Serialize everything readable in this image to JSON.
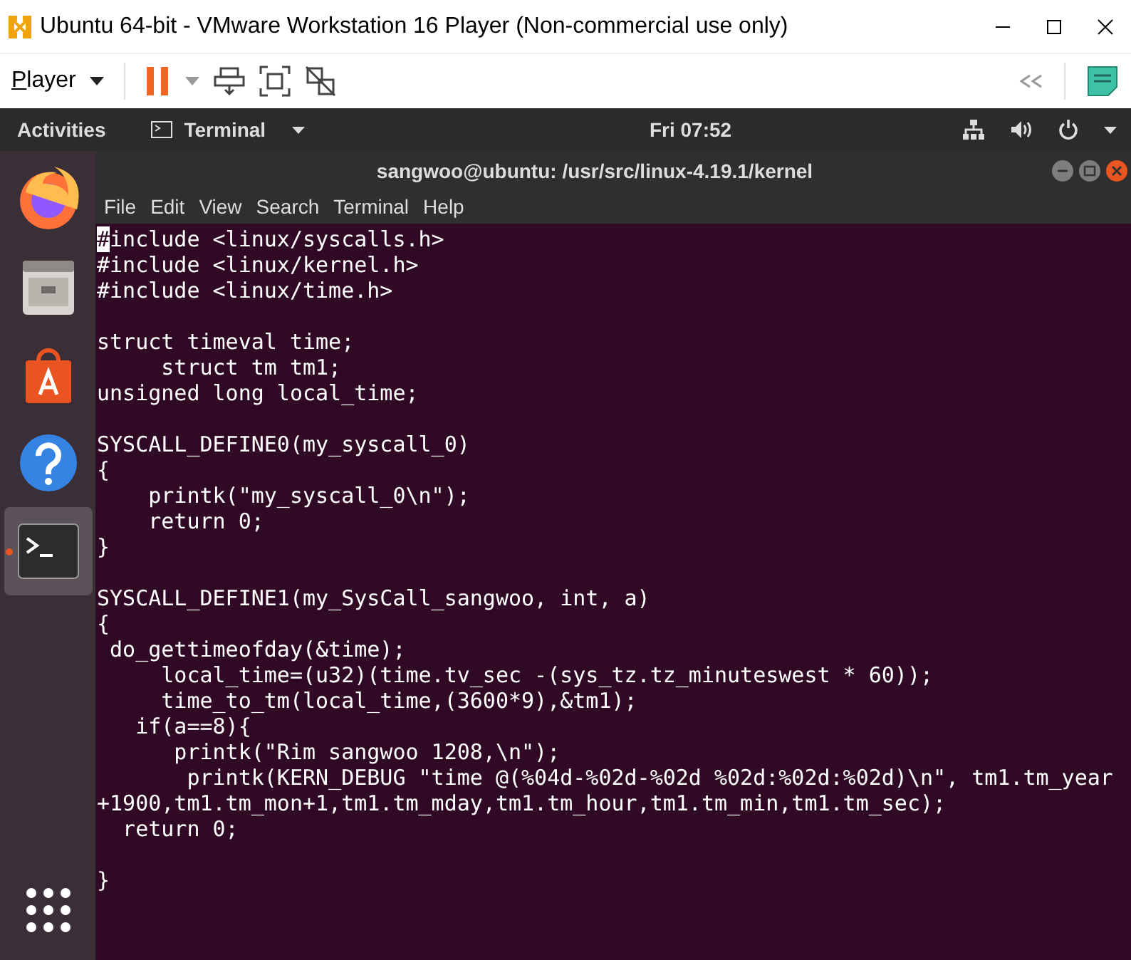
{
  "window": {
    "title": "Ubuntu 64-bit - VMware Workstation 16 Player (Non-commercial use only)"
  },
  "toolbar": {
    "player_menu": "Player",
    "paused": true
  },
  "top_bar": {
    "activities": "Activities",
    "app": "Terminal",
    "clock": "Fri 07:52"
  },
  "dock": [
    {
      "kind": "firefox",
      "selected": false,
      "running": false
    },
    {
      "kind": "files",
      "selected": false,
      "running": false
    },
    {
      "kind": "software",
      "selected": false,
      "running": false
    },
    {
      "kind": "help",
      "selected": false,
      "running": false
    },
    {
      "kind": "terminal",
      "selected": true,
      "running": true
    },
    {
      "kind": "apps",
      "selected": false,
      "running": false
    }
  ],
  "terminal": {
    "title": "sangwoo@ubuntu: /usr/src/linux-4.19.1/kernel",
    "menu": [
      "File",
      "Edit",
      "View",
      "Search",
      "Terminal",
      "Help"
    ],
    "cursor_on_first_char": true,
    "blocks": [
      [
        "#include <linux/syscalls.h>",
        "#include <linux/kernel.h>",
        "#include <linux/time.h>"
      ],
      [
        "struct timeval time;",
        "     struct tm tm1;",
        "unsigned long local_time;"
      ],
      [
        "SYSCALL_DEFINE0(my_syscall_0)",
        "{",
        "    printk(\"my_syscall_0\\n\");",
        "    return 0;",
        "}"
      ],
      [
        "SYSCALL_DEFINE1(my_SysCall_sangwoo, int, a)",
        "{",
        " do_gettimeofday(&time);",
        "     local_time=(u32)(time.tv_sec -(sys_tz.tz_minuteswest * 60));",
        "     time_to_tm(local_time,(3600*9),&tm1);",
        "   if(a==8){",
        "      printk(\"Rim sangwoo 1208,\\n\");",
        "       printk(KERN_DEBUG \"time @(%04d-%02d-%02d %02d:%02d:%02d)\\n\", tm1.tm_year",
        "+1900,tm1.tm_mon+1,tm1.tm_mday,tm1.tm_hour,tm1.tm_min,tm1.tm_sec);",
        "  return 0;"
      ],
      [
        "}"
      ]
    ]
  }
}
